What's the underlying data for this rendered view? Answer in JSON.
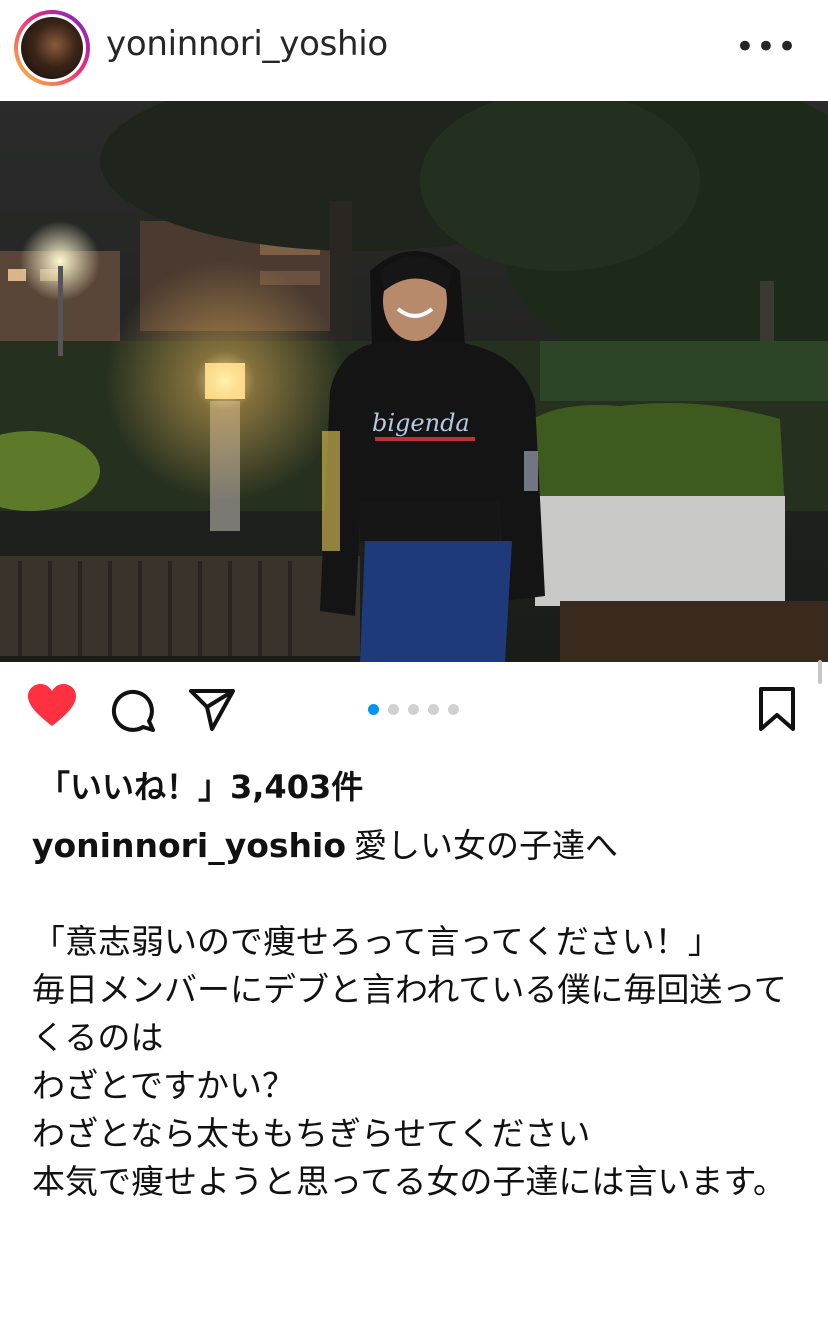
{
  "post": {
    "username": "yoninnori_yoshio",
    "more_label": "•••",
    "likes_text": "「いいね！」3,403件",
    "caption": "愛しい女の子達へ\n\n「意志弱いので痩せろって言ってください！」\n毎日メンバーにデブと言われている僕に毎回送ってくるのは\nわざとですかい？\nわざとなら太ももちぎらせてください\n本気で痩せようと思ってる女の子達には言います。",
    "carousel": {
      "total": 5,
      "current": 1
    }
  },
  "photo": {
    "hoodie_text": "bigenda"
  },
  "colors": {
    "like": "#ff3040",
    "dot_active": "#0095f6",
    "dot_inactive": "#d0d0d0"
  },
  "icons": [
    "heart-icon",
    "comment-icon",
    "share-icon",
    "bookmark-icon",
    "more-icon"
  ]
}
